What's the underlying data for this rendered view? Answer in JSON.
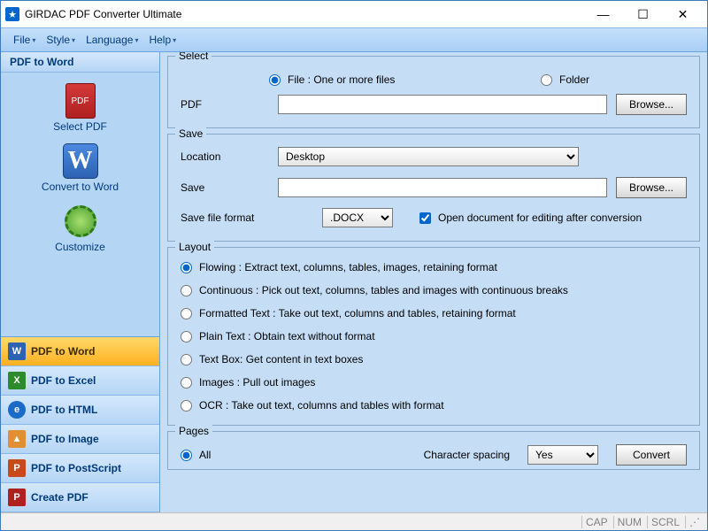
{
  "titlebar": {
    "title": "GIRDAC PDF Converter Ultimate"
  },
  "menu": {
    "file": "File",
    "style": "Style",
    "language": "Language",
    "help": "Help"
  },
  "sidebar": {
    "header": "PDF to Word",
    "select_pdf": "Select PDF",
    "convert_word": "Convert to Word",
    "customize": "Customize",
    "nav": {
      "word": "PDF to Word",
      "excel": "PDF to Excel",
      "html": "PDF to HTML",
      "image": "PDF to Image",
      "postscript": "PDF to PostScript",
      "create": "Create PDF"
    }
  },
  "select_group": {
    "title": "Select",
    "file_label": "File :  One or more files",
    "folder_label": "Folder",
    "pdf_label": "PDF",
    "pdf_value": "",
    "browse": "Browse..."
  },
  "save_group": {
    "title": "Save",
    "location_label": "Location",
    "location_value": "Desktop",
    "save_label": "Save",
    "save_value": "",
    "browse": "Browse...",
    "format_label": "Save file format",
    "format_value": ".DOCX",
    "open_after": "Open document for editing after conversion"
  },
  "layout_group": {
    "title": "Layout",
    "flowing": "Flowing :  Extract text, columns, tables, images, retaining format",
    "continuous": "Continuous :  Pick out text, columns, tables and images with continuous breaks",
    "formatted": "Formatted Text :  Take out text, columns and tables, retaining format",
    "plain": "Plain Text :  Obtain text without format",
    "textbox": "Text Box: Get content in text boxes",
    "images": "Images :  Pull out images",
    "ocr": "OCR :  Take out text, columns and tables with format"
  },
  "pages_group": {
    "title": "Pages",
    "all": "All",
    "charspacing_label": "Character spacing",
    "charspacing_value": "Yes",
    "convert": "Convert"
  },
  "status": {
    "cap": "CAP",
    "num": "NUM",
    "scrl": "SCRL"
  }
}
